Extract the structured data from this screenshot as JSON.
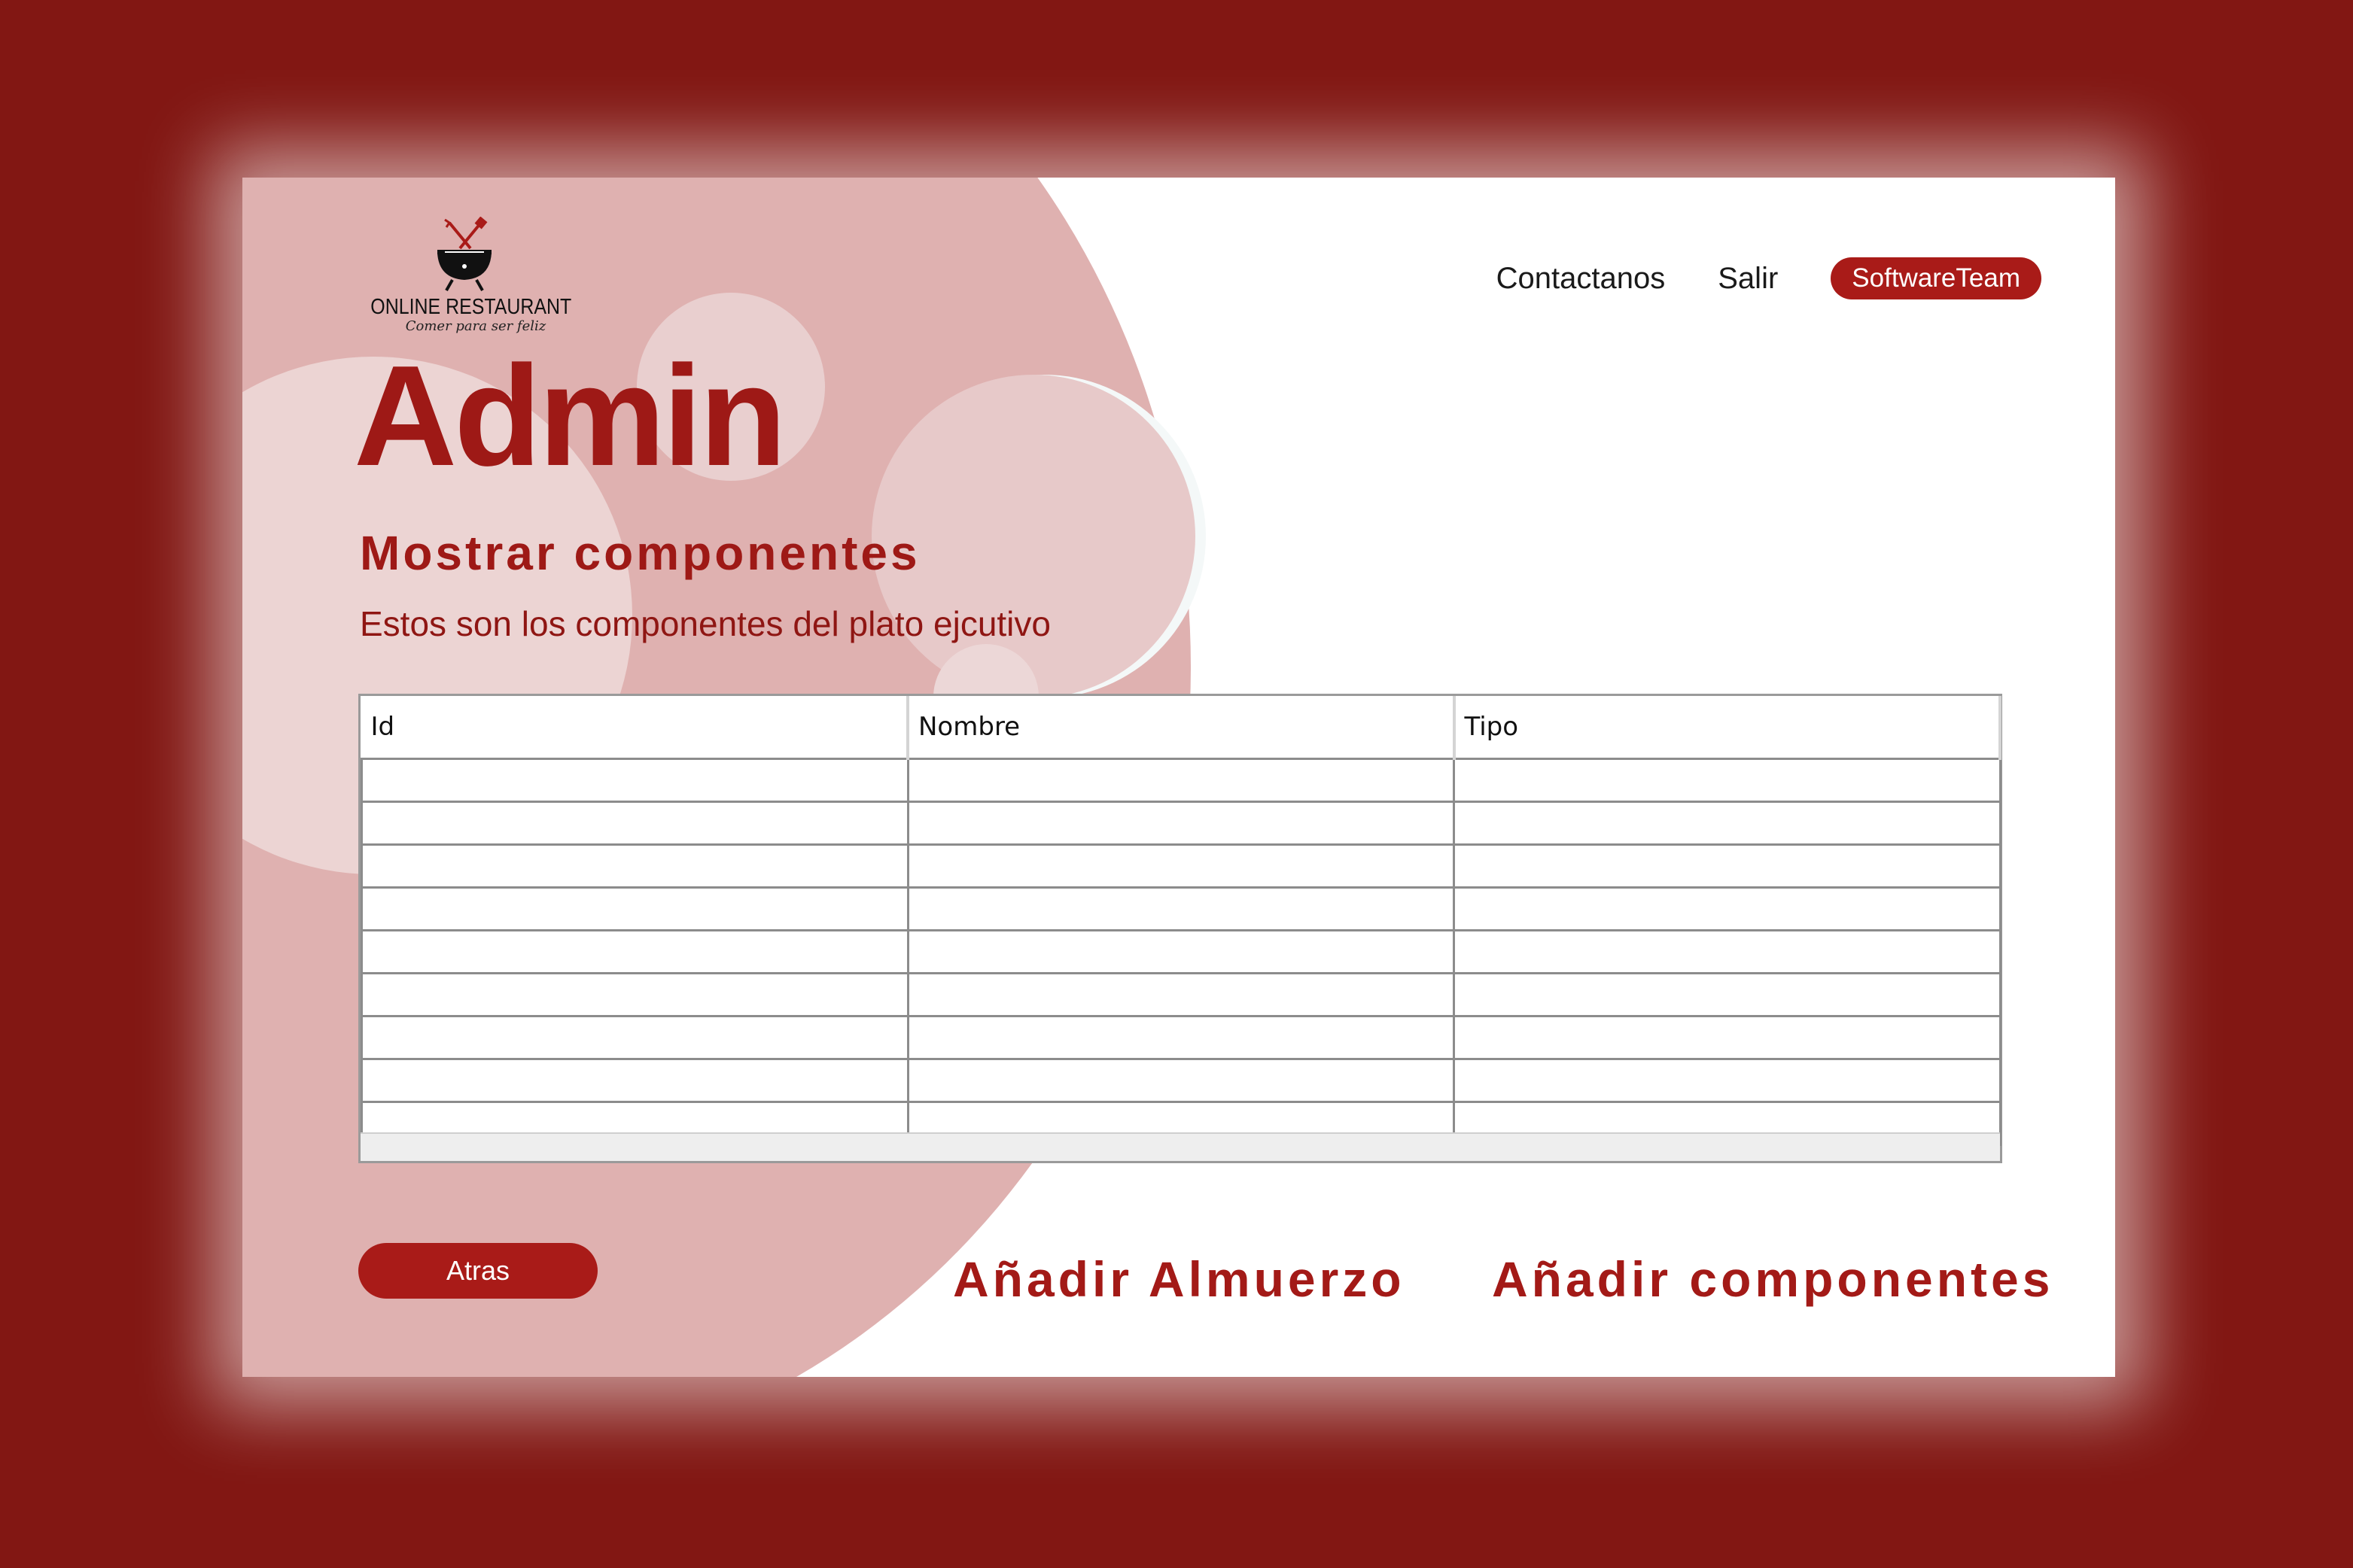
{
  "brand": {
    "name": "ONLINE RESTAURANT",
    "tagline": "Comer para ser feliz",
    "logo_icon": "grill-icon",
    "accent_color": "#a91b18",
    "background_color": "#821713"
  },
  "nav": {
    "contact": "Contactanos",
    "logout": "Salir",
    "team_badge": "SoftwareTeam"
  },
  "page": {
    "title": "Admin",
    "subtitle": "Mostrar componentes",
    "description": "Estos son los componentes del plato ejcutivo"
  },
  "table": {
    "columns": [
      "Id",
      "Nombre",
      "Tipo"
    ],
    "rows": [
      [
        "",
        "",
        ""
      ],
      [
        "",
        "",
        ""
      ],
      [
        "",
        "",
        ""
      ],
      [
        "",
        "",
        ""
      ],
      [
        "",
        "",
        ""
      ],
      [
        "",
        "",
        ""
      ],
      [
        "",
        "",
        ""
      ],
      [
        "",
        "",
        ""
      ],
      [
        "",
        "",
        ""
      ]
    ]
  },
  "actions": {
    "back": "Atras",
    "add_lunch": "Añadir Almuerzo",
    "add_components": "Añadir componentes"
  }
}
